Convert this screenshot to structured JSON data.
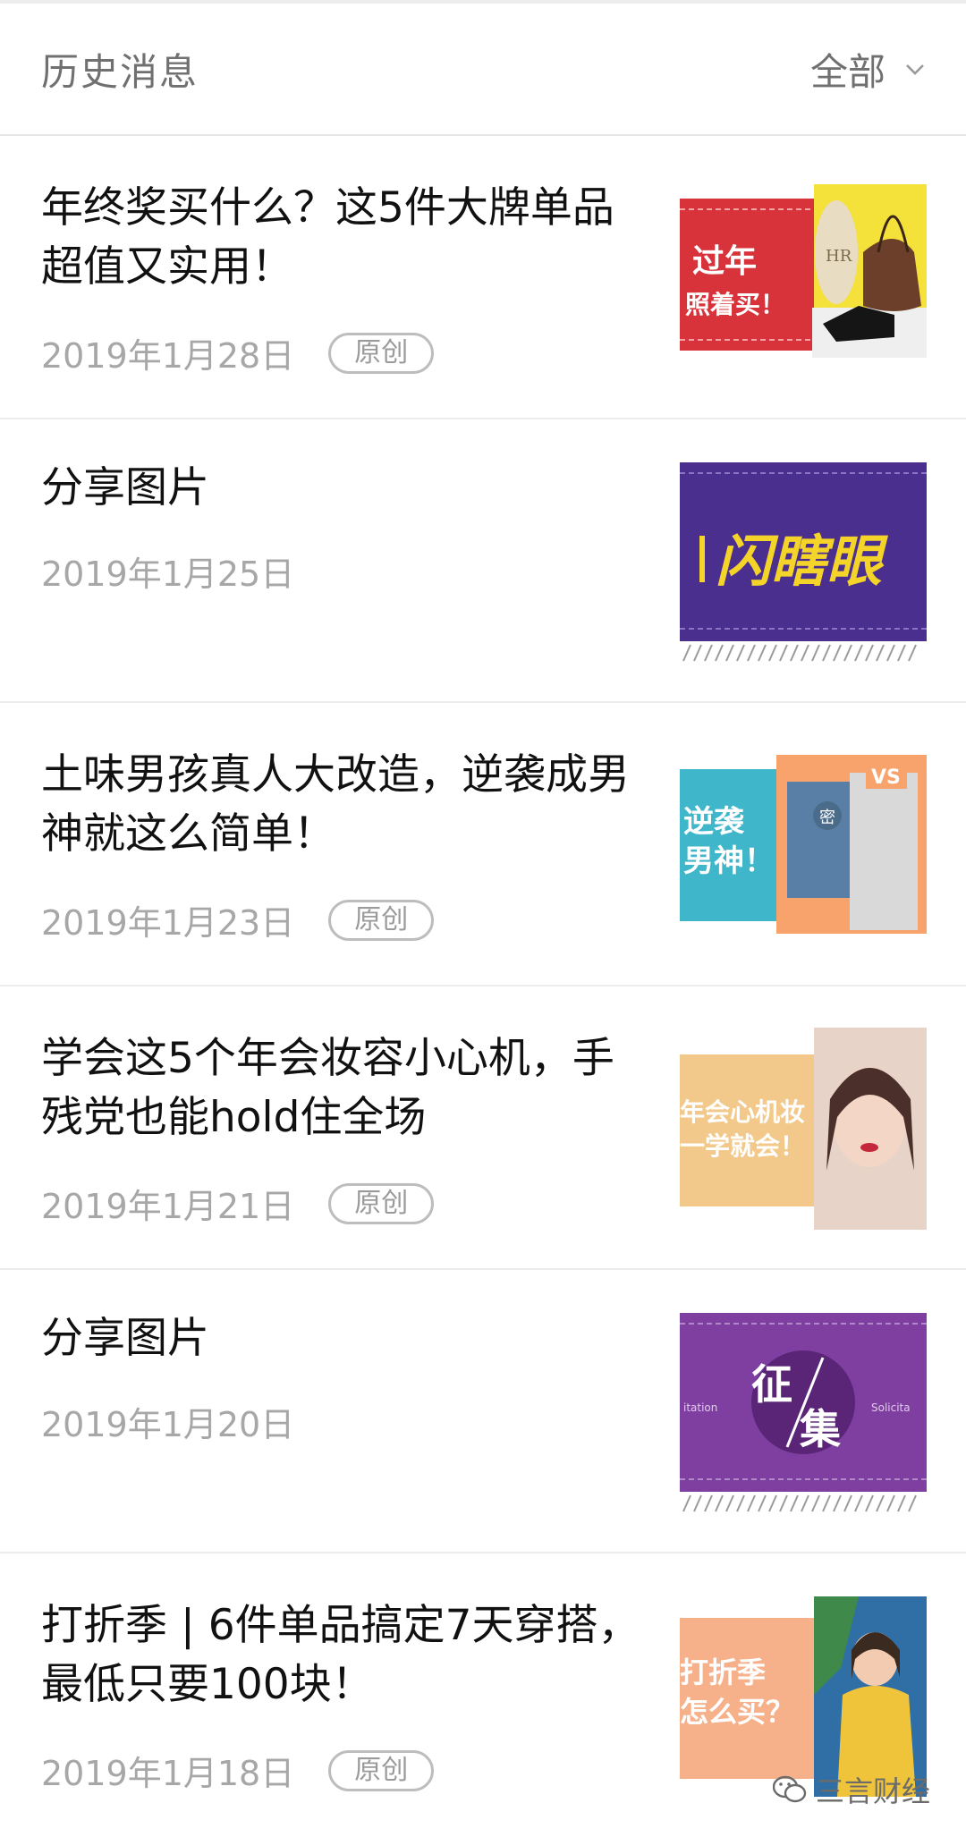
{
  "header": {
    "title": "历史消息",
    "filter_label": "全部"
  },
  "articles": [
    {
      "title": "年终奖买什么？这5件大牌单品超值又实用！",
      "date": "2019年1月28日",
      "tag": "原创",
      "thumb_text": [
        "过年",
        "照着买！"
      ],
      "thumb_logo": "HR"
    },
    {
      "title": "分享图片",
      "date": "2019年1月25日",
      "tag": "",
      "thumb_text": [
        "闪瞎眼"
      ]
    },
    {
      "title": "土味男孩真人大改造，逆袭成男神就这么简单！",
      "date": "2019年1月23日",
      "tag": "原创",
      "thumb_text": [
        "逆袭",
        "男神！"
      ],
      "thumb_badge": "VS",
      "thumb_face": "密"
    },
    {
      "title": "学会这5个年会妆容小心机，手残党也能hold住全场",
      "date": "2019年1月21日",
      "tag": "原创",
      "thumb_text": [
        "年会心机妆",
        "一学就会！"
      ]
    },
    {
      "title": "分享图片",
      "date": "2019年1月20日",
      "tag": "",
      "thumb_text": [
        "征",
        "集"
      ],
      "thumb_side": [
        "itation",
        "Solicita"
      ]
    },
    {
      "title": "打折季 | 6件单品搞定7天穿搭，最低只要100块！",
      "date": "2019年1月18日",
      "tag": "原创",
      "thumb_text": [
        "打折季",
        "怎么买？"
      ]
    }
  ],
  "watermark": {
    "text": "三言财经",
    "icon": "wechat-icon"
  },
  "colors": {
    "thumb1": "#d8333a",
    "thumb1_accent": "#f4e23a",
    "thumb2": "#4b2f8f",
    "thumb2_text": "#f5d42a",
    "thumb3": "#3fb6c9",
    "thumb3_accent": "#f7a36b",
    "thumb4": "#f2c98a",
    "thumb5": "#7e3fa0",
    "thumb6": "#f6b08a"
  }
}
